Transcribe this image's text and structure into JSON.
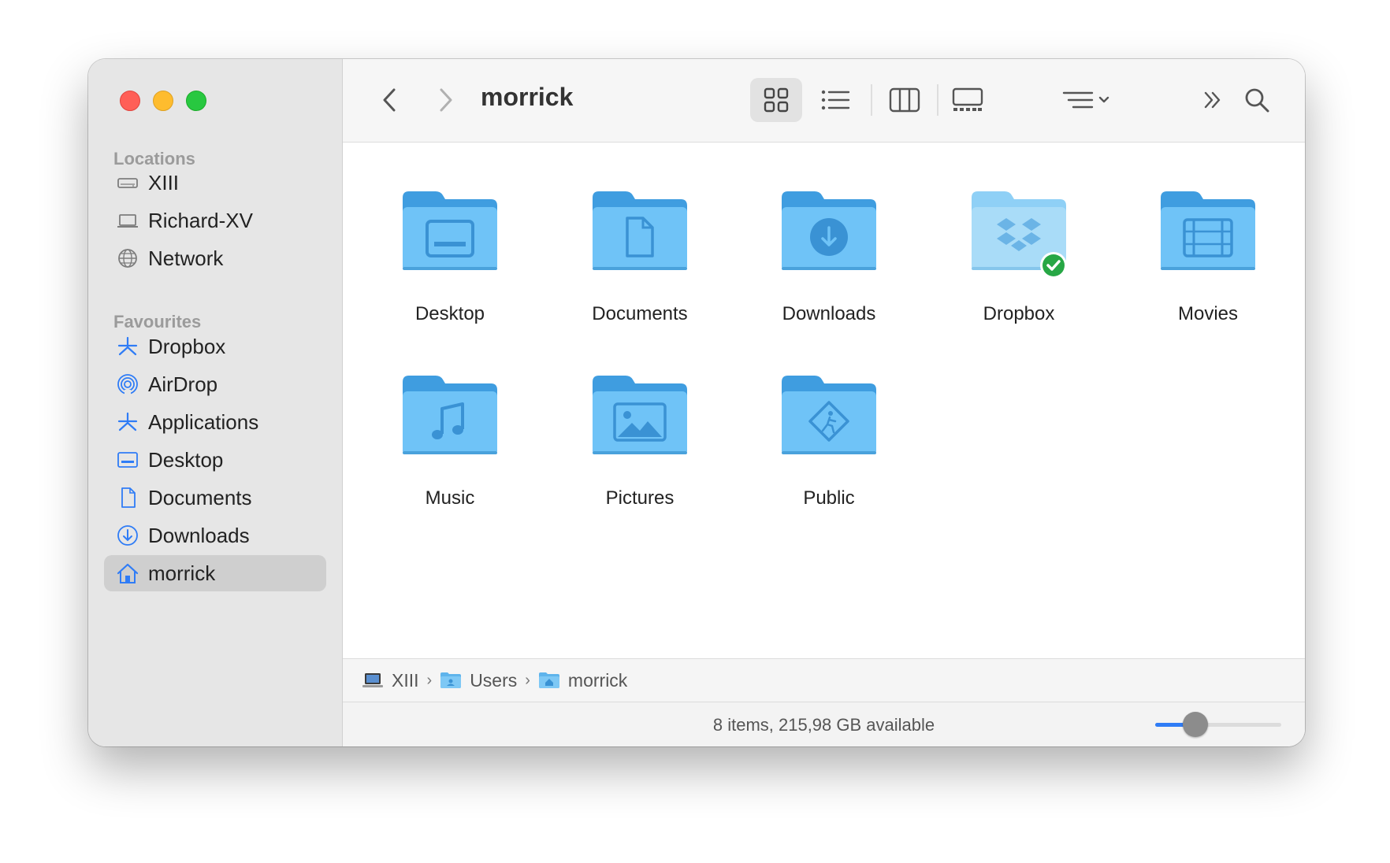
{
  "window": {
    "title": "morrick"
  },
  "sidebar": {
    "sections": {
      "locations": "Locations",
      "favourites": "Favourites"
    },
    "locations": [
      {
        "label": "XIII",
        "icon": "drive-icon"
      },
      {
        "label": "Richard-XV",
        "icon": "laptop-icon"
      },
      {
        "label": "Network",
        "icon": "globe-icon"
      }
    ],
    "favourites": [
      {
        "label": "Dropbox",
        "icon": "dropbox-icon"
      },
      {
        "label": "AirDrop",
        "icon": "airdrop-icon"
      },
      {
        "label": "Applications",
        "icon": "applications-icon"
      },
      {
        "label": "Desktop",
        "icon": "desktop-icon"
      },
      {
        "label": "Documents",
        "icon": "document-icon"
      },
      {
        "label": "Downloads",
        "icon": "download-icon"
      },
      {
        "label": "morrick",
        "icon": "home-icon",
        "selected": true
      }
    ]
  },
  "toolbar": {
    "views": [
      "icon-view",
      "list-view",
      "column-view",
      "gallery-view"
    ],
    "active_view": "icon-view"
  },
  "folders": [
    {
      "label": "Desktop",
      "glyph": "desktop"
    },
    {
      "label": "Documents",
      "glyph": "document"
    },
    {
      "label": "Downloads",
      "glyph": "download"
    },
    {
      "label": "Dropbox",
      "glyph": "dropbox",
      "synced": true
    },
    {
      "label": "Movies",
      "glyph": "film"
    },
    {
      "label": "Music",
      "glyph": "music"
    },
    {
      "label": "Pictures",
      "glyph": "picture"
    },
    {
      "label": "Public",
      "glyph": "public"
    }
  ],
  "pathbar": {
    "crumbs": [
      {
        "label": "XIII",
        "icon": "laptop-icon"
      },
      {
        "label": "Users",
        "icon": "folder-icon"
      },
      {
        "label": "morrick",
        "icon": "home-folder-icon"
      }
    ],
    "separator": "›"
  },
  "status": {
    "text": "8 items, 215,98 GB available",
    "icon_size_level": 0.27
  },
  "colors": {
    "accent": "#2f7cf6",
    "folder_top": "#4aa8e8",
    "folder_body": "#6fc3f7",
    "folder_glyph": "#3a92d4",
    "synced_badge": "#27a745"
  }
}
